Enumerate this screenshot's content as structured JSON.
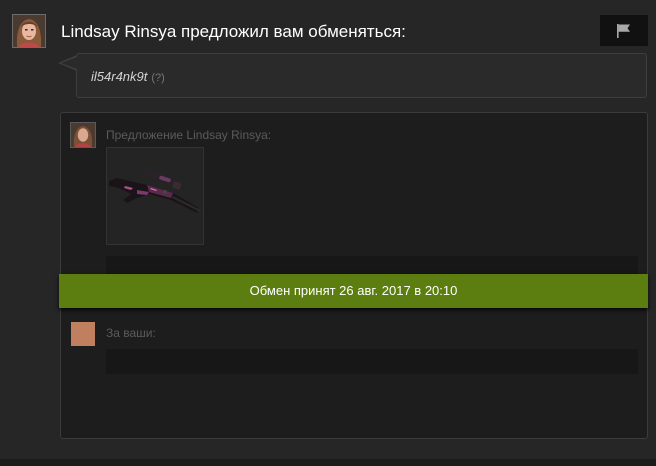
{
  "header": {
    "title": "Lindsay Rinsya предложил вам обменяться:",
    "report_icon": "flag-icon"
  },
  "message": {
    "text": "il54r4nk9t",
    "help": "(?)"
  },
  "offer": {
    "label": "Предложение Lindsay Rinsya:",
    "items": [
      {
        "icon": "sniper-rifle-icon"
      }
    ]
  },
  "status": {
    "text": "Обмен принят 26 авг. 2017 в 20:10",
    "color": "#5c7e10"
  },
  "yours": {
    "label": "За ваши:",
    "avatar_color": "#c08060"
  }
}
